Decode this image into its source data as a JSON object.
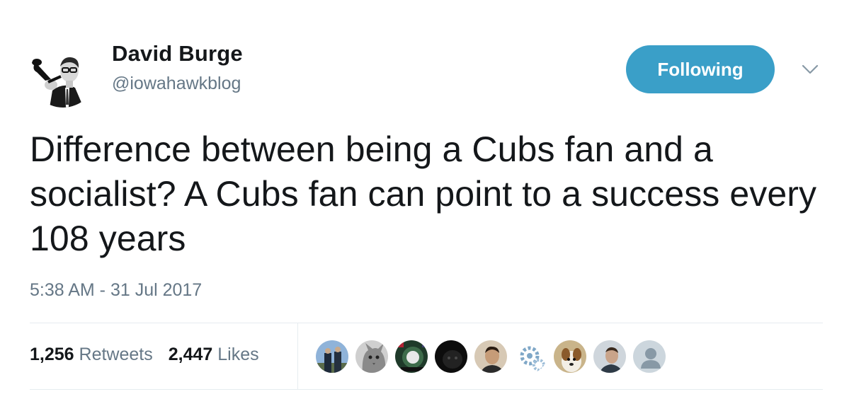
{
  "author": {
    "name": "David Burge",
    "handle": "@iowahawkblog"
  },
  "follow_button": {
    "label": "Following"
  },
  "tweet": {
    "text": "Difference between being a Cubs fan and a socialist? A Cubs fan can point to a success every 108 years",
    "timestamp": "5:38 AM - 31 Jul 2017"
  },
  "stats": {
    "retweets_count": "1,256",
    "retweets_label": "Retweets",
    "likes_count": "2,447",
    "likes_label": "Likes"
  },
  "colors": {
    "follow_button": "#3a9fc8",
    "secondary_text": "#657786",
    "primary_text": "#14171a",
    "divider": "#e6ecf0"
  }
}
